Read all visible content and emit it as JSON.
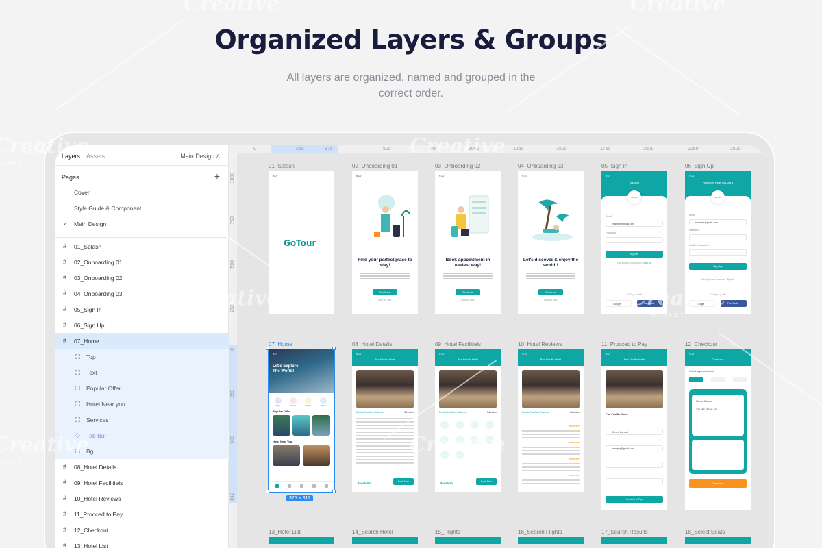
{
  "hero": {
    "title": "Organized Layers & Groups",
    "subtitle": "All layers are organized, named and grouped in the correct order."
  },
  "panel": {
    "tabs": [
      "Layers",
      "Assets"
    ],
    "page_switch": "Main Design ˄",
    "pages_heading": "Pages",
    "add_symbol": "+",
    "pages": [
      "Cover",
      "Style Guide & Component",
      "Main Design"
    ],
    "check": "✓",
    "layers": [
      "01_Splash",
      "02_Onboarding 01",
      "03_Onboarding 02",
      "04_Onboarding 03",
      "05_Sign In",
      "06_Sign Up",
      "07_Home"
    ],
    "home_children": [
      "Top",
      "Text",
      "Popular Offer",
      "Hotel Near you",
      "Services",
      "Tab Bar",
      "Bg"
    ],
    "more_layers": [
      "08_Hotel Details",
      "09_Hotel Facilitiels",
      "10_Hotel Reviews",
      "11_Procced to Pay",
      "12_Checkout",
      "13_Hotel List"
    ],
    "hash": "#"
  },
  "ruler": {
    "top_ticks": [
      "0",
      "250",
      "375",
      "500",
      "750",
      "1000",
      "1250",
      "1500",
      "1750",
      "2000",
      "2250",
      "2500"
    ],
    "left_ticks": [
      "-1000",
      "-750",
      "-500",
      "-250",
      "0",
      "250",
      "500",
      "812"
    ]
  },
  "frames": {
    "row1_labels": [
      "01_Splash",
      "02_Onboarding 01",
      "03_Onboarding 02",
      "04_Onboarding 03",
      "05_Sign In",
      "06_Sign Up"
    ],
    "row2_labels": [
      "07_Home",
      "08_Hotel Details",
      "09_Hotel Facilitiels",
      "10_Hotel Reviews",
      "11_Procced to Pay",
      "12_Checkout"
    ],
    "row3_labels": [
      "13_Hotel List",
      "14_Search Hotel",
      "15_Flights",
      "16_Search Flights",
      "17_Search Results",
      "18_Select Seats"
    ],
    "time": "9:27",
    "logo": "GoTour",
    "onboarding_titles": [
      "Find your perfect place to stay!",
      "Book appointment in easiest way!",
      "Let's discover & enjoy the world!!"
    ],
    "continue": "Continue",
    "skip": "Skip for now",
    "sign_in_title": "Sign In",
    "sign_up_title": "Register New Account",
    "brand_mini": "GoTour",
    "email_label": "Email",
    "email_value": "example@gmail.com",
    "password_label": "Password",
    "confirm_label": "Confirm Password",
    "sign_in_btn": "Sign In",
    "sign_up_btn": "Sign Up",
    "no_account": "Don't have an account?",
    "sign_up_link": "Sign Up",
    "have_account": "Already have account?",
    "sign_in_link": "Sign In",
    "or_sign_in": "Or Sign in with",
    "or_sign_up": "Or Sign up with",
    "google": "Google",
    "facebook": "Facebook",
    "home_greet": "Let's Explore The World!",
    "services": [
      "Trips",
      "Hotels",
      "Flights",
      "Offers"
    ],
    "popular_offer": "Popular Offer",
    "hotel_near": "Hotel Near You",
    "hotel_name": "Pan Pacific Hotel",
    "detail_tabs": "Details  Facilities  Reviews",
    "direction": "Direction",
    "price": "$1200.00",
    "book_now": "Book Now",
    "rating": "★★★★★",
    "proceed": "Procced to Pay",
    "checkout": "Checkout",
    "select_payment": "Select payment method",
    "card_holder": "Steven Gerrard",
    "card_number": "123 456 789 00 345",
    "checkout_btn": "Checkout",
    "size_tag": "375 × 812"
  },
  "watermark": {
    "text": "Creative",
    "sub": "MARKET"
  },
  "colors": {
    "teal": "#0fa6a6",
    "selection": "#2d8cf0",
    "orange": "#f7931e",
    "title": "#1a1c3d"
  }
}
